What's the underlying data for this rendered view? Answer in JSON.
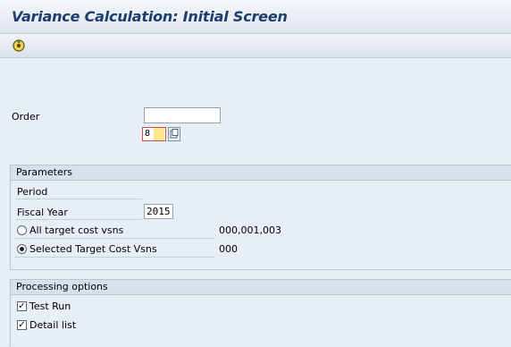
{
  "window": {
    "title": "Variance Calculation: Initial Screen"
  },
  "toolbar": {
    "execute_icon": "execute-icon"
  },
  "order": {
    "label": "Order",
    "value": ""
  },
  "parameters": {
    "heading": "Parameters",
    "period_label": "Period",
    "period_value": "8",
    "fiscal_year_label": "Fiscal Year",
    "fiscal_year_value": "2015",
    "all_target_label": "All target cost vsns",
    "all_target_value": "000,001,003",
    "selected_target_label": "Selected Target Cost Vsns",
    "selected_target_value": "000",
    "selected_option": "selected"
  },
  "processing": {
    "heading": "Processing options",
    "test_run_label": "Test Run",
    "test_run_checked": true,
    "detail_list_label": "Detail list",
    "detail_list_checked": true
  },
  "colors": {
    "title": "#1c3d6e",
    "background": "#e7eef5",
    "focus_border": "#c9504a",
    "focus_fill": "#fde98a"
  }
}
